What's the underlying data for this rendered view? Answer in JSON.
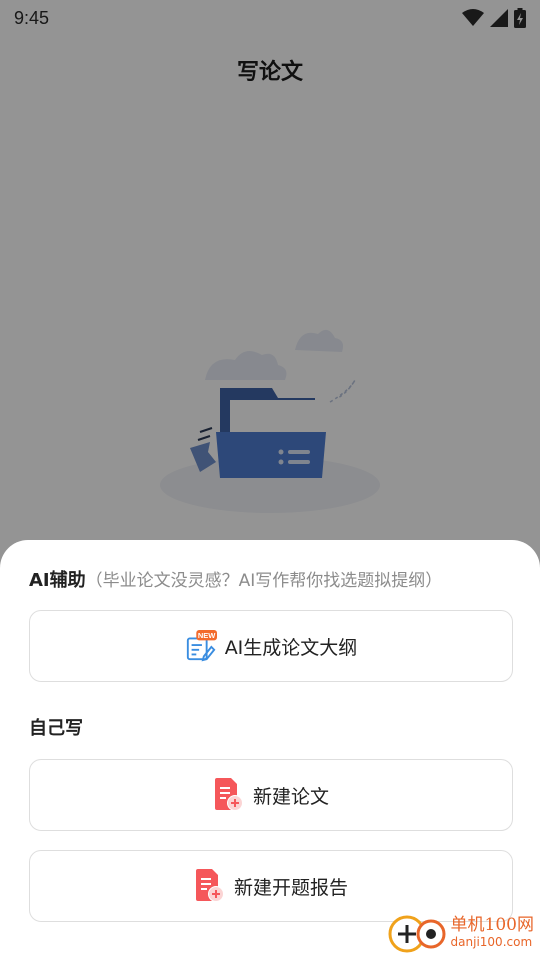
{
  "status_bar": {
    "time": "9:45"
  },
  "header": {
    "title": "写论文"
  },
  "sheet": {
    "ai_section": {
      "title": "AI辅助",
      "hint": "（毕业论文没灵感？AI写作帮你找选题拟提纲）",
      "button_label": "AI生成论文大纲",
      "badge": "NEW"
    },
    "self_section": {
      "title": "自己写",
      "buttons": [
        {
          "label": "新建论文"
        },
        {
          "label": "新建开题报告"
        }
      ]
    }
  },
  "watermark": {
    "name": "单机100网",
    "url": "danji100.com"
  },
  "colors": {
    "accent_red": "#f5575a",
    "watermark_orange": "#e8662a",
    "folder_blue": "#4e7cd0"
  }
}
